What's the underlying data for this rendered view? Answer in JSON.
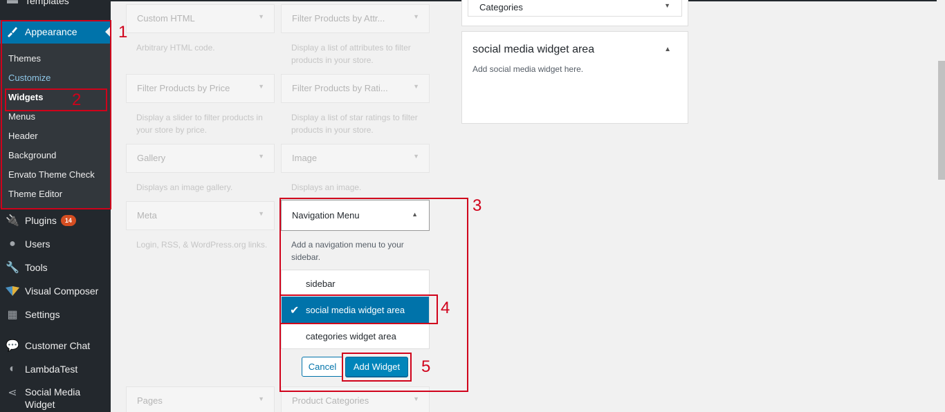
{
  "sidebar": {
    "top_item": "Templates",
    "appearance": "Appearance",
    "submenu": [
      "Themes",
      "Customize",
      "Widgets",
      "Menus",
      "Header",
      "Background",
      "Envato Theme Check",
      "Theme Editor"
    ],
    "plugins": "Plugins",
    "plugins_badge": "14",
    "users": "Users",
    "tools": "Tools",
    "visual_composer": "Visual Composer",
    "settings": "Settings",
    "customer_chat": "Customer Chat",
    "lambdatest": "LambdaTest",
    "social_media_widget_1": "Social Media",
    "social_media_widget_2": "Widget"
  },
  "widgets": {
    "custom_html": {
      "title": "Custom HTML",
      "desc": "Arbitrary HTML code."
    },
    "filter_attr": {
      "title": "Filter Products by Attr...",
      "desc": "Display a list of attributes to filter products in your store."
    },
    "filter_price": {
      "title": "Filter Products by Price",
      "desc": "Display a slider to filter products in your store by price."
    },
    "filter_rating": {
      "title": "Filter Products by Rati...",
      "desc": "Display a list of star ratings to filter products in your store."
    },
    "gallery": {
      "title": "Gallery",
      "desc": "Displays an image gallery."
    },
    "image": {
      "title": "Image",
      "desc": "Displays an image."
    },
    "meta": {
      "title": "Meta",
      "desc": "Login, RSS, & WordPress.org links."
    },
    "pages": {
      "title": "Pages"
    },
    "product_categories": {
      "title": "Product Categories"
    }
  },
  "nav_menu_widget": {
    "title": "Navigation Menu",
    "desc": "Add a navigation menu to your sidebar.",
    "options": [
      "sidebar",
      "social media widget area",
      "categories widget area"
    ],
    "selected": "social media widget area",
    "cancel": "Cancel",
    "add": "Add Widget"
  },
  "areas": {
    "categories_title": "Categories",
    "social_title": "social media widget area",
    "social_desc": "Add social media widget here."
  },
  "annotations": [
    "1",
    "2",
    "3",
    "4",
    "5"
  ],
  "colors": {
    "accent": "#0073aa",
    "annotation": "#d0021b",
    "sidebar_bg": "#23282d"
  }
}
